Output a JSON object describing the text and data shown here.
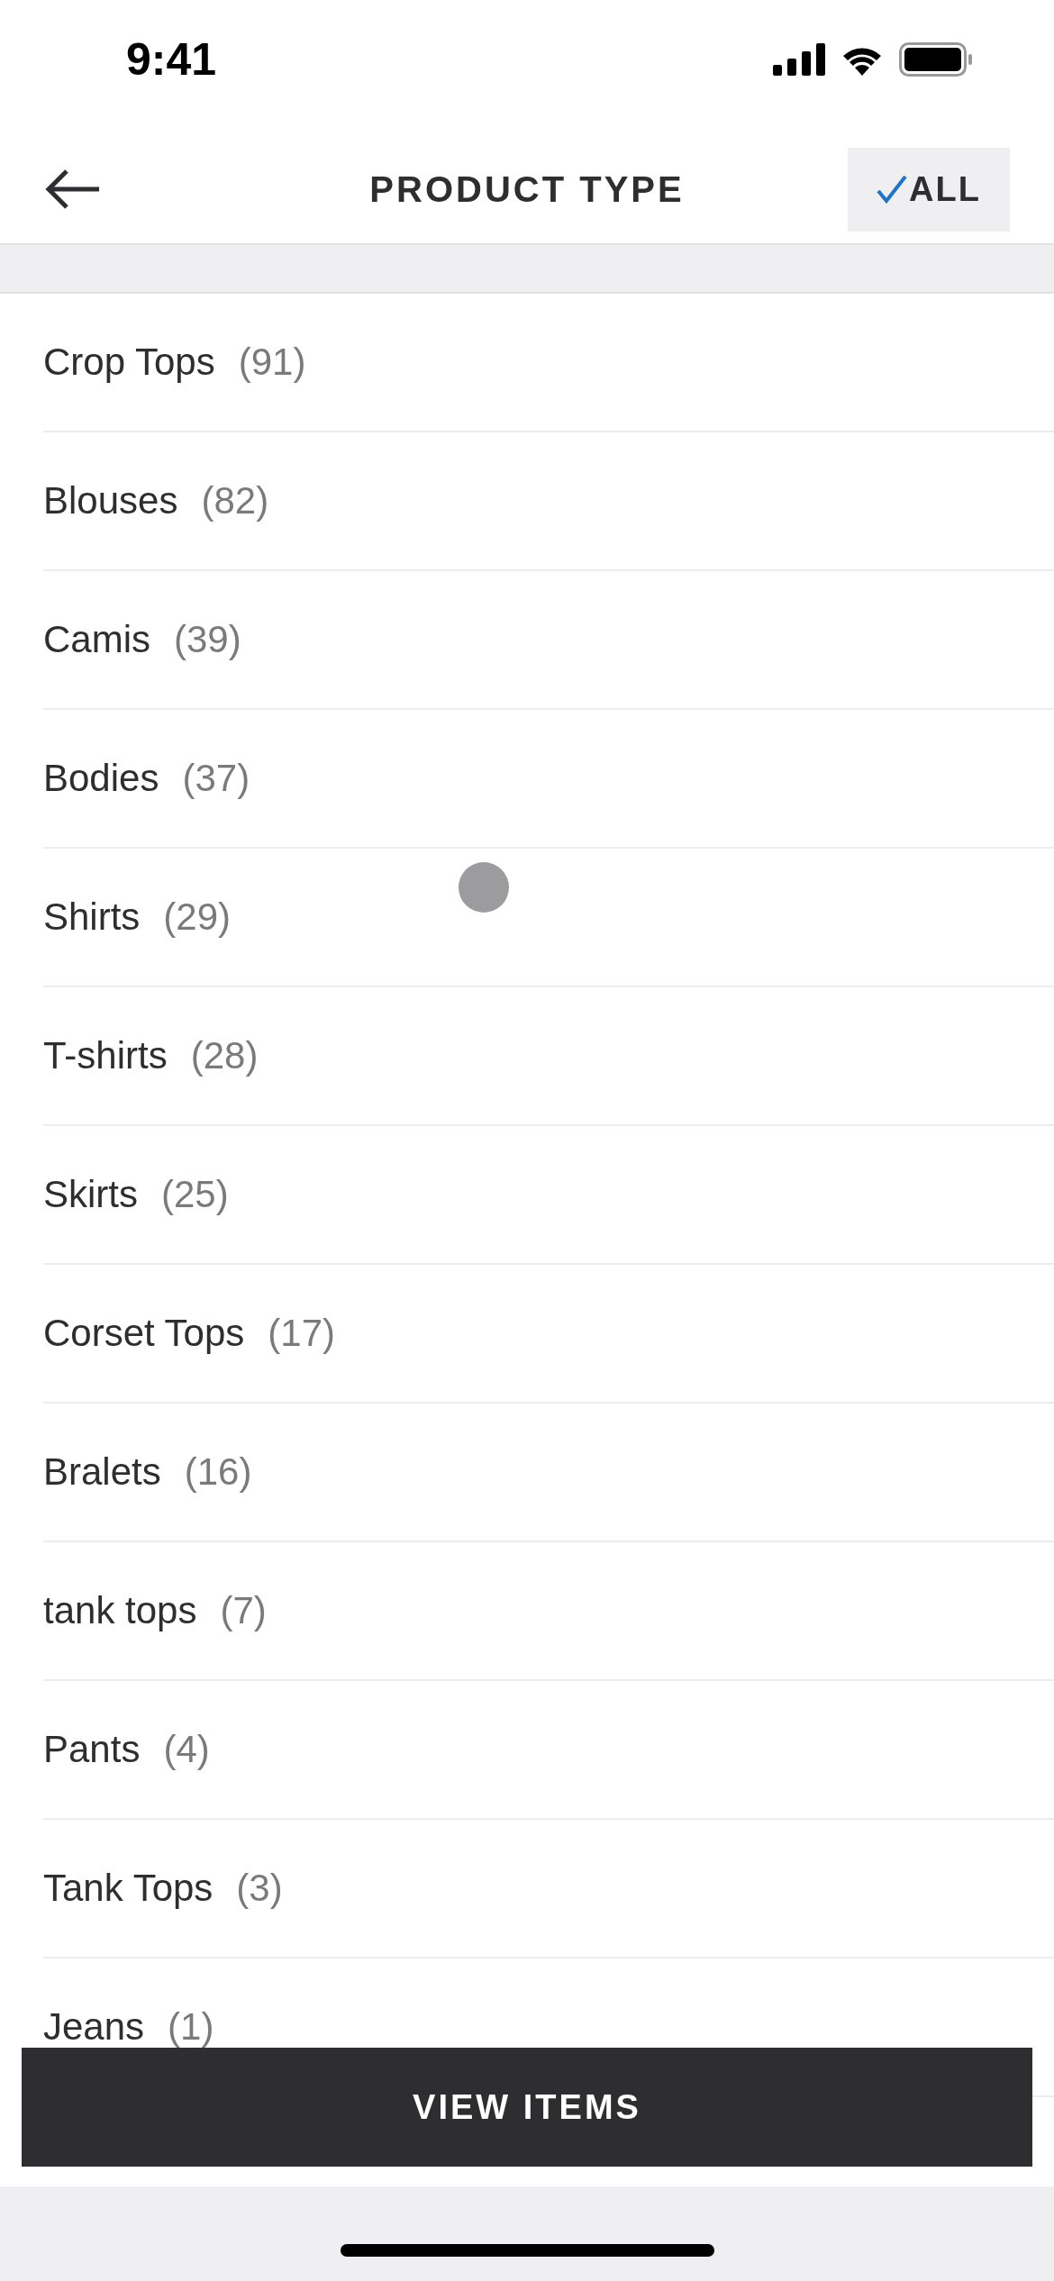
{
  "status_bar": {
    "time": "9:41"
  },
  "header": {
    "title": "PRODUCT TYPE",
    "all_button": {
      "label": "ALL",
      "checked": true
    }
  },
  "items": [
    {
      "name": "Crop Tops",
      "count": "(91)"
    },
    {
      "name": "Blouses",
      "count": "(82)"
    },
    {
      "name": "Camis",
      "count": "(39)"
    },
    {
      "name": "Bodies",
      "count": "(37)"
    },
    {
      "name": "Shirts",
      "count": "(29)"
    },
    {
      "name": "T-shirts",
      "count": "(28)"
    },
    {
      "name": "Skirts",
      "count": "(25)"
    },
    {
      "name": "Corset Tops",
      "count": "(17)"
    },
    {
      "name": "Bralets",
      "count": "(16)"
    },
    {
      "name": "tank tops",
      "count": "(7)"
    },
    {
      "name": "Pants",
      "count": "(4)"
    },
    {
      "name": "Tank Tops",
      "count": "(3)"
    },
    {
      "name": "Jeans",
      "count": "(1)"
    }
  ],
  "view_button": {
    "label": "VIEW ITEMS"
  }
}
